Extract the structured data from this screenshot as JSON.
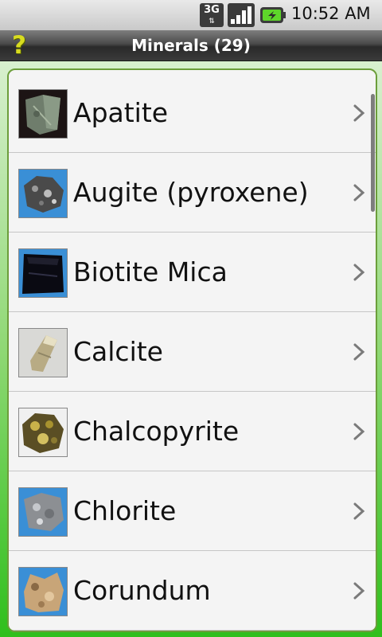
{
  "status_bar": {
    "network": "3G",
    "time": "10:52 AM"
  },
  "app": {
    "title": "Minerals (29)",
    "help_label": "?"
  },
  "list": {
    "items": [
      {
        "label": "Apatite",
        "icon": "apatite-thumbnail"
      },
      {
        "label": "Augite (pyroxene)",
        "icon": "augite-thumbnail"
      },
      {
        "label": "Biotite Mica",
        "icon": "biotite-thumbnail"
      },
      {
        "label": "Calcite",
        "icon": "calcite-thumbnail"
      },
      {
        "label": "Chalcopyrite",
        "icon": "chalcopyrite-thumbnail"
      },
      {
        "label": "Chlorite",
        "icon": "chlorite-thumbnail"
      },
      {
        "label": "Corundum",
        "icon": "corundum-thumbnail"
      }
    ]
  },
  "colors": {
    "accent_green": "#2fbf1c",
    "help_yellow": "#d8dc1f",
    "title_bar": "#3a3a3a"
  }
}
